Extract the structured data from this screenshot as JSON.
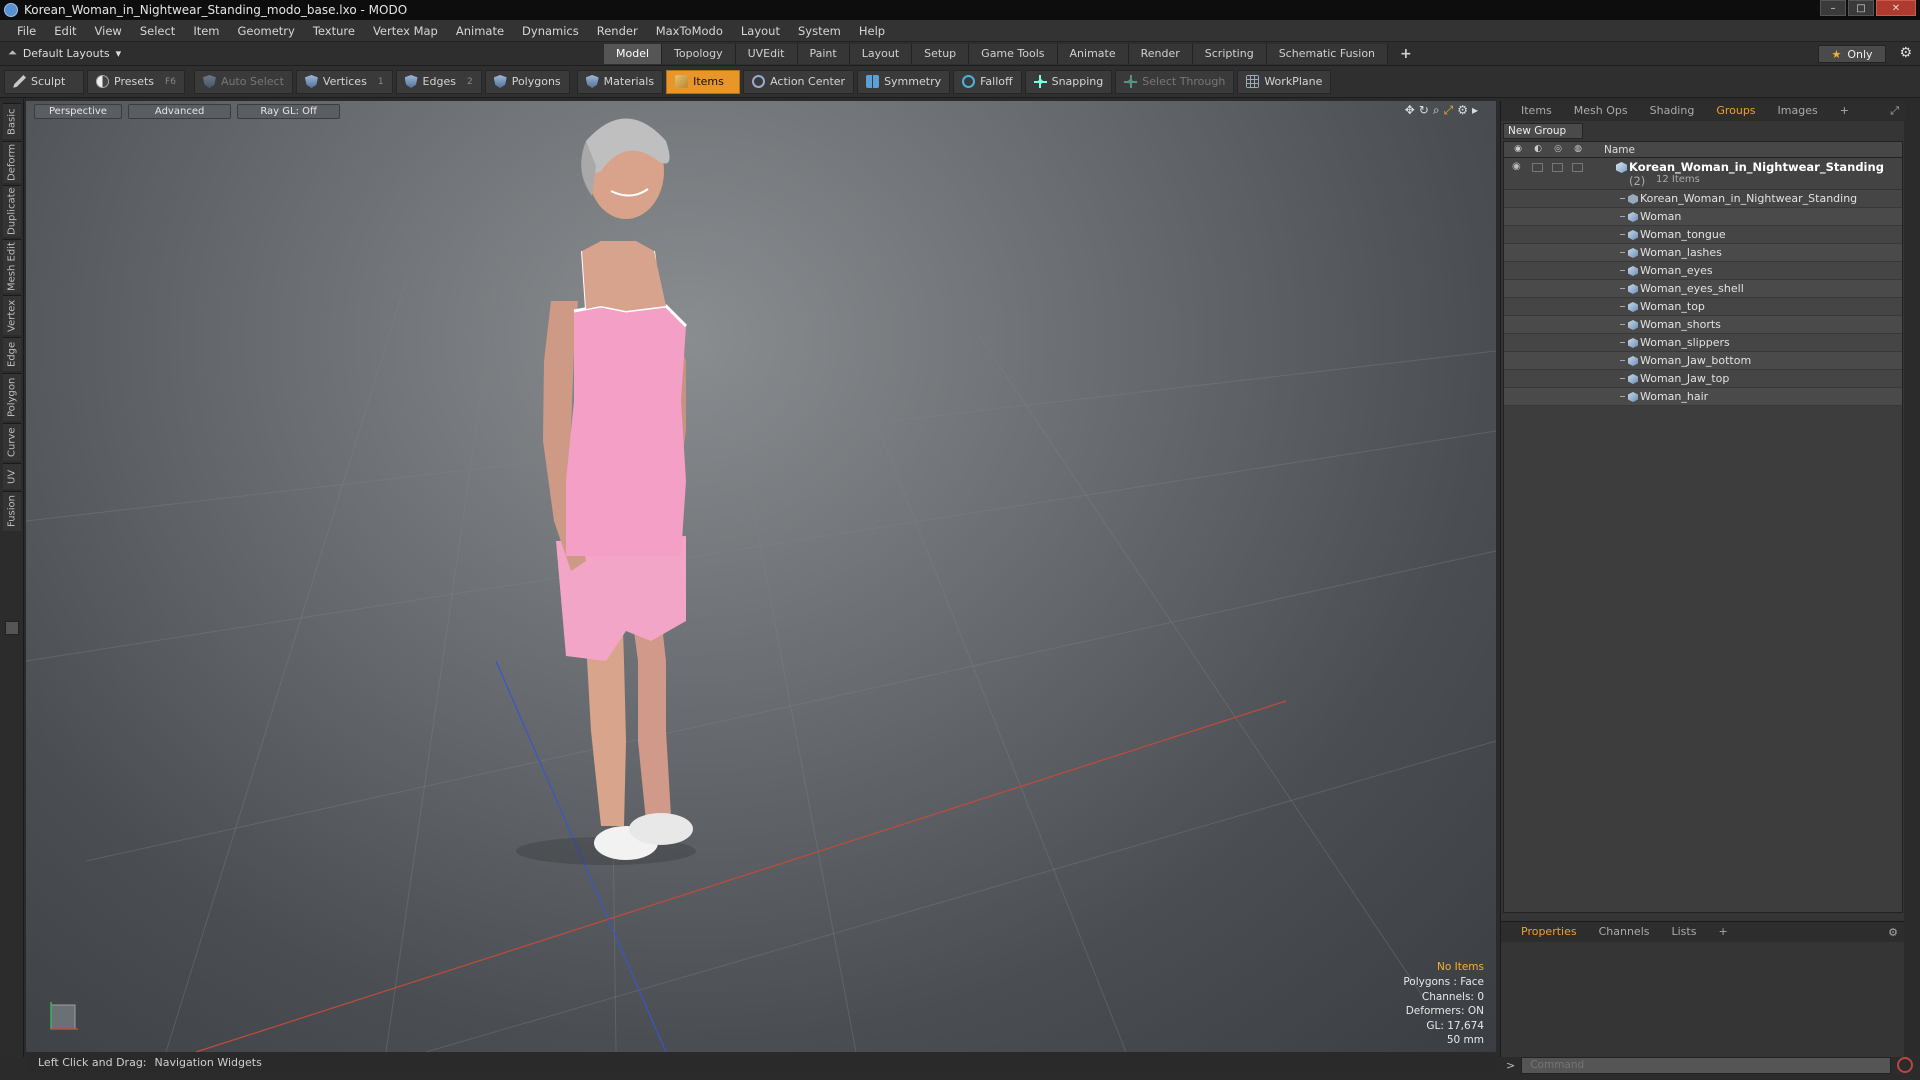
{
  "window": {
    "title": "Korean_Woman_in_Nightwear_Standing_modo_base.lxo - MODO"
  },
  "menu": [
    "File",
    "Edit",
    "View",
    "Select",
    "Item",
    "Geometry",
    "Texture",
    "Vertex Map",
    "Animate",
    "Dynamics",
    "Render",
    "MaxToModo",
    "Layout",
    "System",
    "Help"
  ],
  "layout_selector": "Default Layouts",
  "layout_tabs": [
    {
      "label": "Model",
      "active": true
    },
    {
      "label": "Topology"
    },
    {
      "label": "UVEdit"
    },
    {
      "label": "Paint"
    },
    {
      "label": "Layout"
    },
    {
      "label": "Setup"
    },
    {
      "label": "Game Tools"
    },
    {
      "label": "Animate"
    },
    {
      "label": "Render"
    },
    {
      "label": "Scripting"
    },
    {
      "label": "Schematic Fusion"
    }
  ],
  "only_button": "Only",
  "toolbar": {
    "sculpt": "Sculpt",
    "presets": "Presets",
    "presets_key": "F6",
    "auto_select": "Auto Select",
    "vertices": "Vertices",
    "vertices_key": "1",
    "edges": "Edges",
    "edges_key": "2",
    "polygons": "Polygons",
    "materials": "Materials",
    "items": "Items",
    "action_center": "Action Center",
    "symmetry": "Symmetry",
    "falloff": "Falloff",
    "snapping": "Snapping",
    "select_through": "Select Through",
    "workplane": "WorkPlane"
  },
  "left_tabs": [
    "Basic",
    "Deform",
    "Duplicate",
    "Mesh Edit",
    "Vertex",
    "Edge",
    "Polygon",
    "Curve",
    "UV",
    "Fusion"
  ],
  "viewport": {
    "view": "Perspective",
    "advanced": "Advanced",
    "raygl": "Ray GL: Off",
    "info": {
      "selection": "No Items",
      "polygons": "Polygons : Face",
      "channels": "Channels: 0",
      "deformers": "Deformers: ON",
      "gl": "GL: 17,674",
      "focal": "50 mm"
    }
  },
  "right_tabs": [
    {
      "label": "Items"
    },
    {
      "label": "Mesh Ops"
    },
    {
      "label": "Shading"
    },
    {
      "label": "Groups",
      "active": true
    },
    {
      "label": "Images"
    }
  ],
  "groups": {
    "new_group": "New Group",
    "name_header": "Name",
    "group_name": "Korean_Woman_in_Nightwear_Standing",
    "group_count": "(2)",
    "group_sub": "12 Items",
    "items": [
      "Korean_Woman_in_Nightwear_Standing",
      "Woman",
      "Woman_tongue",
      "Woman_lashes",
      "Woman_eyes",
      "Woman_eyes_shell",
      "Woman_top",
      "Woman_shorts",
      "Woman_slippers",
      "Woman_Jaw_bottom",
      "Woman_Jaw_top",
      "Woman_hair"
    ]
  },
  "bottom_tabs": [
    {
      "label": "Properties",
      "active": true
    },
    {
      "label": "Channels"
    },
    {
      "label": "Lists"
    }
  ],
  "status": {
    "left": "Left Click and Drag:",
    "right": "Navigation Widgets"
  },
  "command": {
    "placeholder": "Command"
  },
  "colors": {
    "accent": "#e8962a",
    "tab_active": "#f0a030"
  }
}
